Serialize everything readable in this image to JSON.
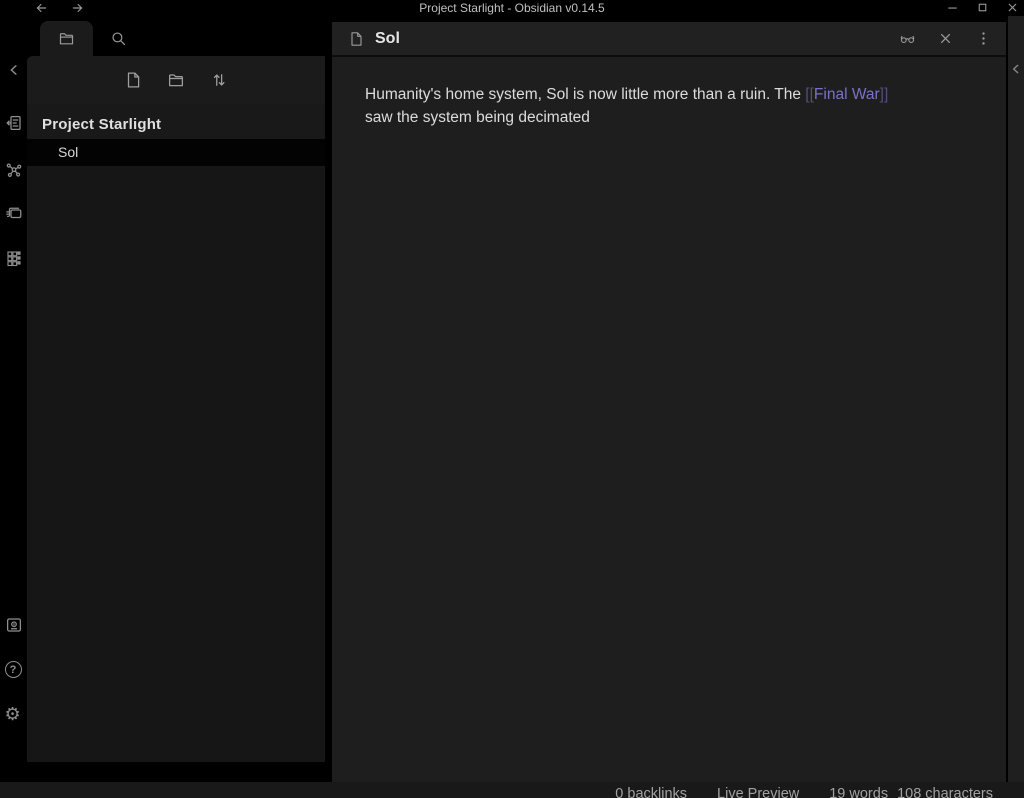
{
  "titlebar": {
    "title": "Project Starlight - Obsidian v0.14.5"
  },
  "sidebar": {
    "vault_title": "Project Starlight",
    "files": [
      {
        "name": "Sol",
        "selected": true
      }
    ]
  },
  "editor": {
    "tab_title": "Sol",
    "content": {
      "before_link": "Humanity's home system, Sol is now little more than a ruin. The ",
      "bracket_open": "[[",
      "link_text": "Final War",
      "bracket_close": "]]",
      "after_link": "saw the system being decimated"
    }
  },
  "status_bar": {
    "items": [
      "0 backlinks",
      "Live Preview",
      "19 words",
      "108 characters"
    ]
  },
  "icons": {
    "help_glyph": "?",
    "gear_glyph": "⚙"
  },
  "colors": {
    "app_background": "#000000",
    "editor_background": "#1e1e1e",
    "panel_background": "#1b1b1b",
    "selected_file_background": "#030303",
    "link_text": "#7b71c9",
    "link_brackets": "#544e79",
    "body_text": "#dcdcdc",
    "muted_icon": "#9a9a9a"
  }
}
